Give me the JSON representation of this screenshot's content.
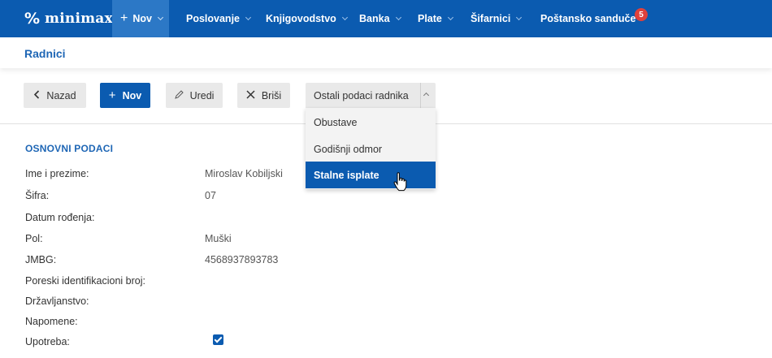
{
  "topnav": {
    "logo_text": "minimax",
    "new_label": "Nov",
    "items": [
      {
        "label": "Poslovanje"
      },
      {
        "label": "Knjigovodstvo"
      },
      {
        "label": "Banka"
      },
      {
        "label": "Plate"
      },
      {
        "label": "Šifarnici"
      },
      {
        "label": "Poštansko sanduče"
      }
    ],
    "mailbox_badge": "5"
  },
  "page": {
    "title": "Radnici"
  },
  "toolbar": {
    "back_label": "Nazad",
    "new_label": "Nov",
    "edit_label": "Uredi",
    "delete_label": "Briši",
    "more_label": "Ostali podaci radnika"
  },
  "dropdown": {
    "items": [
      {
        "label": "Obustave"
      },
      {
        "label": "Godišnji odmor"
      },
      {
        "label": "Stalne isplate"
      }
    ]
  },
  "section": {
    "title": "OSNOVNI PODACI",
    "rows": [
      {
        "label": "Ime i prezime:",
        "value": "Miroslav Kobiljski"
      },
      {
        "label": "Šifra:",
        "value": "07"
      },
      {
        "label": "Datum rođenja:",
        "value": ""
      },
      {
        "label": "Pol:",
        "value": "Muški"
      },
      {
        "label": "JMBG:",
        "value": "4568937893783"
      },
      {
        "label": "Poreski identifikacioni broj:",
        "value": ""
      },
      {
        "label": "Državljanstvo:",
        "value": ""
      },
      {
        "label": "Napomene:",
        "value": ""
      },
      {
        "label": "Upotreba:",
        "value": ""
      }
    ]
  },
  "colors": {
    "brand_blue": "#0b5bb0",
    "accent_blue": "#1e66b5",
    "badge_red": "#e0413b"
  },
  "icons": {
    "logo": "percent-logo-icon",
    "cursor": "hand-pointer-icon"
  }
}
